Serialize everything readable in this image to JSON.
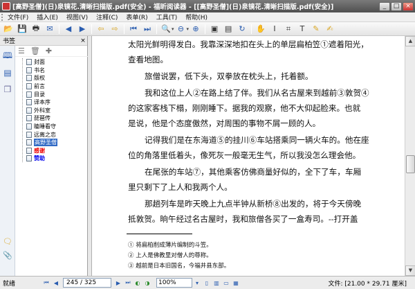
{
  "window": {
    "title": "[高野圣僧](日)泉镜花.清晰扫描版.pdf(安全) - 福昕阅读器 - [[高野圣僧](日)泉镜花.清晰扫描版.pdf(安全)]",
    "min_label": "_",
    "max_label": "□",
    "close_label": "×"
  },
  "menu": [
    "文件(F)",
    "插入(E)",
    "视图(V)",
    "注释(C)",
    "表单(R)",
    "工具(T)",
    "帮助(H)"
  ],
  "toolbar": {
    "icons": [
      "open-icon",
      "save-icon",
      "print-icon",
      "email-icon",
      "prev-page-icon",
      "next-page-icon",
      "back-icon",
      "forward-icon",
      "first-page-icon",
      "last-page-icon",
      "zoom-in-icon",
      "zoom-out-icon",
      "actual-size-icon",
      "fit-width-icon",
      "rotate-icon",
      "hand-icon",
      "select-icon",
      "snapshot-icon",
      "typewriter-icon",
      "highlight-icon",
      "comment-icon"
    ]
  },
  "left_pane": {
    "title": "书签",
    "close": "×",
    "bookmarks": [
      {
        "label": "封面",
        "style": "normal"
      },
      {
        "label": "书名",
        "style": "normal"
      },
      {
        "label": "版权",
        "style": "normal"
      },
      {
        "label": "前言",
        "style": "normal"
      },
      {
        "label": "目录",
        "style": "normal"
      },
      {
        "label": "译本序",
        "style": "normal"
      },
      {
        "label": "外科室",
        "style": "normal"
      },
      {
        "label": "琵琶传",
        "style": "normal"
      },
      {
        "label": "瞌睡看守",
        "style": "normal"
      },
      {
        "label": "远离之恋",
        "style": "normal"
      },
      {
        "label": "高野圣僧",
        "style": "selected"
      },
      {
        "label": "感谢",
        "style": "red"
      },
      {
        "label": "赞助",
        "style": "blue"
      }
    ]
  },
  "document": {
    "lines": [
      "太阳光鲜明得发白。我靠深深地扣在头上的单层扁柏笠①遮着阳光，",
      "查看地图。",
      "旅僧说罢，低下头，双拳放在枕头上，托着额。",
      "我和这位上人②在路上结了伴。我们从名古屋来到越前③敦贺④",
      "的这家客栈下榻，刚刚睡下。据我的观察，他不大仰起脸来。也就",
      "是说，他是个态度傲然，对周围的事物不屑一顾的人。",
      "记得我们是在东海道⑤的挂川⑥车站搭乘同一辆火车的。他在座",
      "位的角落里低着头，像死灰一般毫无生气，所以我没怎么理会他。",
      "在尾张的车站⑦，其他乘客仿佛商量好似的，全下了车，车厢",
      "里只剩下了上人和我两个人。",
      "那趟列车是昨天晚上九点半钟从新桥⑧出发的，将于今天傍晚",
      "抵敦贺。晌午经过名古屋时，我和旅僧各买了一盒寿司。--打开盖"
    ],
    "footnotes": [
      "① 将扁柏削成薄片编制的斗笠。",
      "② 上人是佛教里对僧人的尊称。",
      "③ 越前是日本旧国名，今福井县东部。"
    ]
  },
  "status": {
    "left_text": "就绪",
    "page_display": "245 / 325",
    "zoom": "100%",
    "doc_size": "文件: [21.00 * 29.71 厘米]"
  }
}
